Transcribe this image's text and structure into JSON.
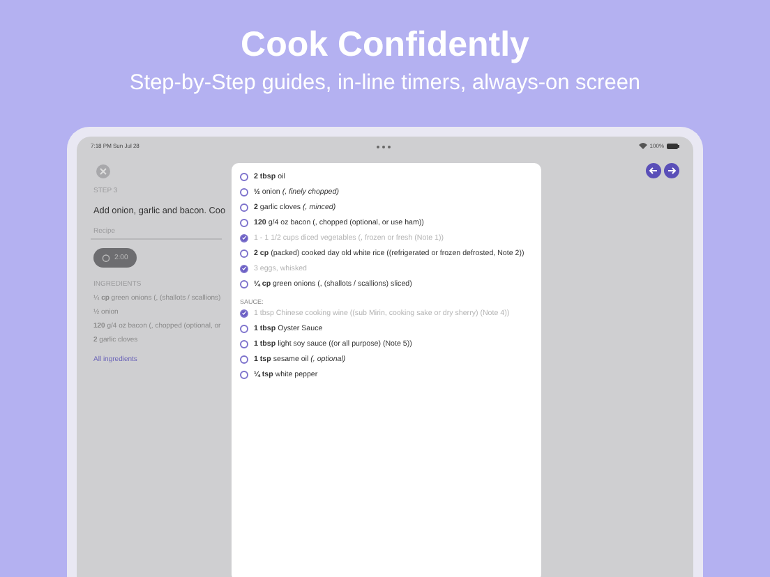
{
  "header": {
    "title": "Cook Confidently",
    "subtitle": "Step-by-Step guides, in-line timers, always-on screen"
  },
  "status_bar": {
    "time": "7:18 PM  Sun Jul 28",
    "battery": "100%"
  },
  "step": {
    "label": "STEP 3",
    "instruction": "Add onion, garlic and bacon. Coo",
    "notes_placeholder": "Recipe",
    "timer": "2:00"
  },
  "ingredients": {
    "heading": "INGREDIENTS",
    "items": [
      "¼ **cp** green onions (, (shallots / scallions)",
      "½ onion",
      "**120** g/4 oz bacon (, chopped (optional, or",
      "**2** garlic cloves"
    ],
    "link": "All ingredients"
  },
  "sheet": {
    "items": [
      {
        "kind": "ingredient",
        "text": "**2 tbsp** oil",
        "checked": false
      },
      {
        "kind": "ingredient",
        "text": "**½** onion *(, finely chopped)*",
        "checked": false
      },
      {
        "kind": "ingredient",
        "text": "**2** garlic cloves *(, minced)*",
        "checked": false
      },
      {
        "kind": "ingredient",
        "text": "**120** g/4 oz bacon (, chopped (optional, or use ham))",
        "checked": false
      },
      {
        "kind": "ingredient",
        "text": "1 - 1 1/2 cups diced vegetables (, frozen or fresh (Note 1))",
        "checked": true
      },
      {
        "kind": "ingredient",
        "text": "**2 cp** (packed) cooked day old white rice ((refrigerated or frozen defrosted, Note 2))",
        "checked": false
      },
      {
        "kind": "ingredient",
        "text": "3 eggs, whisked",
        "checked": true
      },
      {
        "kind": "ingredient",
        "text": "**¼ cp** green onions (, (shallots / scallions) sliced)",
        "checked": false
      },
      {
        "kind": "heading",
        "text": "SAUCE:"
      },
      {
        "kind": "ingredient",
        "text": "1 tbsp Chinese cooking wine ((sub Mirin, cooking sake or dry sherry) (Note 4))",
        "checked": true
      },
      {
        "kind": "ingredient",
        "text": "**1 tbsp** Oyster Sauce",
        "checked": false
      },
      {
        "kind": "ingredient",
        "text": "**1 tbsp** light soy sauce ((or all purpose) (Note 5))",
        "checked": false
      },
      {
        "kind": "ingredient",
        "text": "**1 tsp** sesame oil *(, optional)*",
        "checked": false
      },
      {
        "kind": "ingredient",
        "text": "**¼ tsp** white pepper",
        "checked": false
      }
    ]
  }
}
